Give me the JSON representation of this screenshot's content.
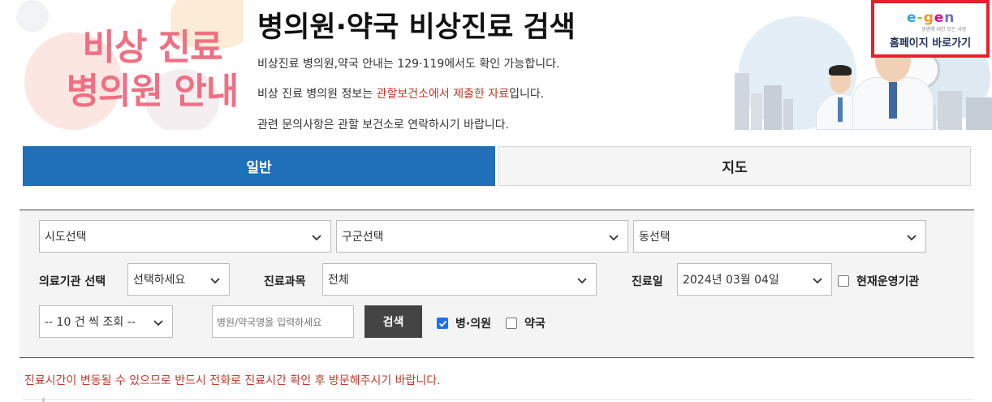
{
  "banner": {
    "image_text_line1": "비상 진료",
    "image_text_line2": "병의원 안내",
    "heading": "병의원·약국 비상진료 검색",
    "info_line1": "비상진료 병의원,약국 안내는 129·119에서도 확인 가능합니다.",
    "info_line2_before": "비상 진료 병의원 정보는 ",
    "info_line2_highlight": "관할보건소에서 제출한 자료",
    "info_line2_after": "입니다.",
    "info_line3": "관련 문의사항은 관할 보건소로 연락하시기 바랍니다.",
    "home_link_logo": "e-gen",
    "home_link_sub": "생명에 대한 모든 사랑",
    "home_link_label": "홈페이지 바로가기",
    "highlight_color": "#c0392b",
    "home_link_border_color": "#e8202a"
  },
  "tabs": [
    {
      "label": "일반",
      "active": true
    },
    {
      "label": "지도",
      "active": false
    }
  ],
  "filters": {
    "sido": {
      "selected": "시도선택"
    },
    "gugun": {
      "selected": "구군선택"
    },
    "dong": {
      "selected": "동선택"
    },
    "institution_label": "의료기관 선택",
    "institution": {
      "selected": "선택하세요"
    },
    "department_label": "진료과목",
    "department": {
      "selected": "전체"
    },
    "date_label": "진료일",
    "date": {
      "selected": "2024년 03월 04일"
    },
    "operating_now_label": "현재운영기관",
    "operating_now_checked": false,
    "page_size": {
      "selected": "-- 10 건 씩 조회 --"
    },
    "name_input": {
      "value": "",
      "placeholder": "병원/약국명을 입력하세요"
    },
    "search_button": "검색",
    "hospital_label": "병·의원",
    "hospital_checked": true,
    "pharmacy_label": "약국",
    "pharmacy_checked": false
  },
  "notice": "진료시간이 변동될 수 있으므로 반드시 전화로 진료시간 확인 후 방문해주시기 바랍니다.",
  "colors": {
    "tab_active": "#1f6fb9",
    "search_button": "#444444",
    "notice": "#c0392b",
    "banner_pink": "#ef6f83"
  },
  "icons": [
    "chevron-down-icon",
    "checkbox-checked-icon",
    "checkbox-empty-icon",
    "egen-logo-icon"
  ]
}
